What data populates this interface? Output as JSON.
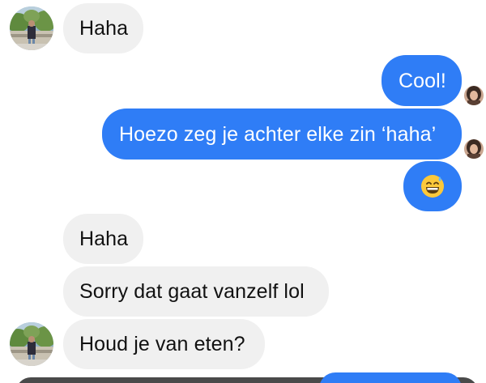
{
  "messages": [
    {
      "text": "Haha"
    },
    {
      "text": "Cool!"
    },
    {
      "text": "Hoezo zeg je achter elke zin ‘haha’"
    },
    {
      "text": "Haha"
    },
    {
      "text": "Sorry dat gaat vanzelf lol"
    },
    {
      "text": "Houd je van eten?"
    }
  ],
  "emoji_message": {
    "icon": "grinning-sweat-emoji"
  },
  "colors": {
    "outgoing_bubble": "#2f7df6",
    "incoming_bubble": "#f0f0f0",
    "incoming_text": "#111111",
    "outgoing_text": "#ffffff"
  }
}
